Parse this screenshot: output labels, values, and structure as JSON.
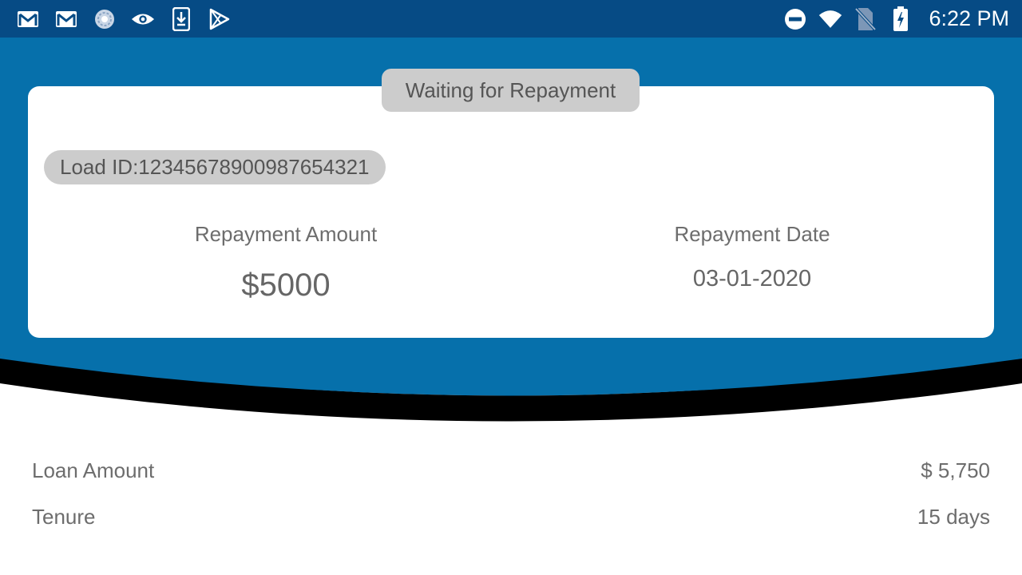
{
  "status_bar": {
    "left_icons": [
      "gmail-icon",
      "gmail-icon",
      "sync-icon",
      "eye-icon",
      "download-icon",
      "play-store-icon"
    ],
    "right_icons": [
      "do-not-disturb-icon",
      "wifi-icon",
      "no-sim-icon",
      "battery-charging-icon"
    ],
    "time": "6:22 PM"
  },
  "colors": {
    "status_bar_bg": "#064b85",
    "header_bg": "#0670ab",
    "curve_shadow": "#000000",
    "pill_bg": "#cccccc",
    "text_gray": "#666666"
  },
  "card": {
    "status_label": "Waiting for Repayment",
    "loan_id": "Load ID:12345678900987654321",
    "repayment_amount_label": "Repayment Amount",
    "repayment_amount_value": "$5000",
    "repayment_date_label": "Repayment Date",
    "repayment_date_value": "03-01-2020"
  },
  "details": [
    {
      "label": "Loan Amount",
      "value": "$ 5,750"
    },
    {
      "label": "Tenure",
      "value": "15 days"
    }
  ]
}
